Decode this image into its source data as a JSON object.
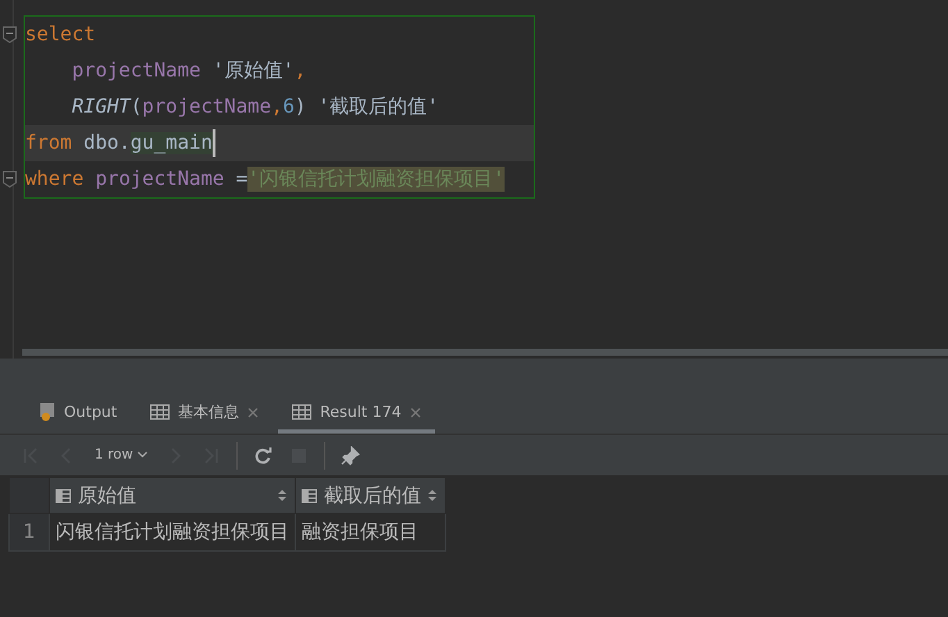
{
  "editor": {
    "lines": [
      {
        "foldable": true,
        "current": false,
        "tokens": [
          {
            "kind": "keyword",
            "text": "select"
          }
        ]
      },
      {
        "foldable": false,
        "current": false,
        "tokens": [
          {
            "kind": "ident",
            "text": "    projectName"
          },
          {
            "kind": "string",
            "text": " '原始值'"
          },
          {
            "kind": "punct",
            "text": ","
          }
        ]
      },
      {
        "foldable": false,
        "current": false,
        "tokens": [
          {
            "kind": "func",
            "text": "    RIGHT"
          },
          {
            "kind": "plain",
            "text": "("
          },
          {
            "kind": "ident",
            "text": "projectName"
          },
          {
            "kind": "punct",
            "text": ","
          },
          {
            "kind": "number",
            "text": "6"
          },
          {
            "kind": "plain",
            "text": ") "
          },
          {
            "kind": "string",
            "text": "'截取后的值'"
          }
        ]
      },
      {
        "foldable": false,
        "current": true,
        "tokens": [
          {
            "kind": "keyword",
            "text": "from"
          },
          {
            "kind": "plain",
            "text": " dbo."
          },
          {
            "kind": "highlight",
            "text": "gu_main"
          },
          {
            "kind": "caret"
          }
        ]
      },
      {
        "foldable": true,
        "current": false,
        "tokens": [
          {
            "kind": "keyword",
            "text": "where"
          },
          {
            "kind": "ident",
            "text": " projectName"
          },
          {
            "kind": "plain",
            "text": " ="
          },
          {
            "kind": "match",
            "text": "'闪银信托计划融资担保项目'"
          }
        ]
      }
    ]
  },
  "tabs": [
    {
      "label": "Output",
      "kind": "output",
      "closable": false,
      "selected": false
    },
    {
      "label": "基本信息",
      "kind": "result",
      "closable": true,
      "selected": false
    },
    {
      "label": "Result 174",
      "kind": "result",
      "closable": true,
      "selected": true
    }
  ],
  "toolbar": {
    "row_count": "1 row",
    "buttons": [
      {
        "kind": "first",
        "disabled": true
      },
      {
        "kind": "prev",
        "disabled": true
      },
      {
        "kind": "count",
        "disabled": false
      },
      {
        "kind": "next",
        "disabled": true
      },
      {
        "kind": "last",
        "disabled": true
      },
      {
        "kind": "sep"
      },
      {
        "kind": "refresh",
        "disabled": false
      },
      {
        "kind": "stop",
        "disabled": true
      },
      {
        "kind": "sep"
      },
      {
        "kind": "pin",
        "disabled": false
      }
    ]
  },
  "table": {
    "columns": [
      "原始值",
      "截取后的值"
    ],
    "rows": [
      {
        "number": "1",
        "cells": [
          "闪银信托计划融资担保项目",
          "融资担保项目"
        ]
      }
    ]
  }
}
